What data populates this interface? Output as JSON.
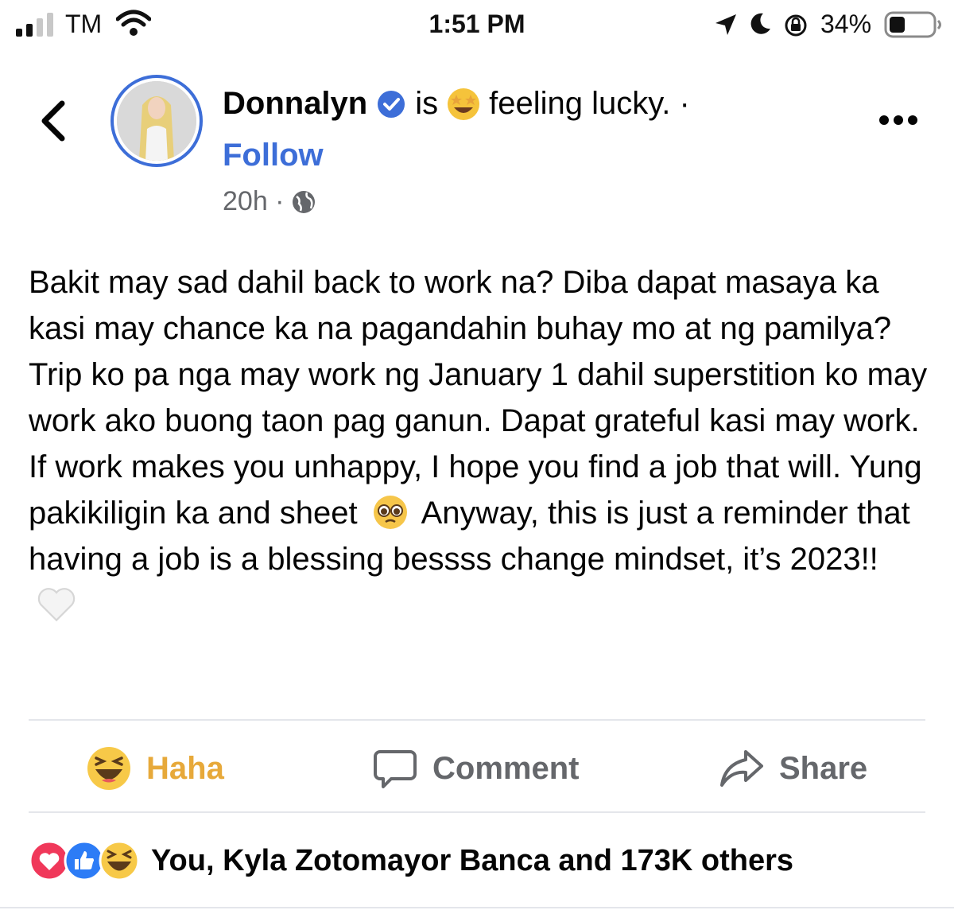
{
  "status_bar": {
    "carrier": "TM",
    "time": "1:51 PM",
    "battery": "34%"
  },
  "post": {
    "author": "Donnalyn",
    "activity_prefix": "is",
    "activity": "feeling lucky. ·",
    "follow_label": "Follow",
    "time_ago": "20h ·",
    "text_parts": [
      "Bakit may sad dahil back to work na? Diba dapat masaya ka kasi may chance ka na pagandahin buhay mo at ng pamilya? Trip ko pa nga may work ng January 1 dahil superstition ko may work ako buong taon pag ganun. Dapat grateful kasi may work. If work makes you unhappy, I hope you find a job that will. Yung pakikiligin ka and sheet",
      "Anyway, this is just a reminder that having a job is a blessing bessss change mindset, it’s 2023!!"
    ]
  },
  "actions": {
    "reaction_label": "Haha",
    "comment_label": "Comment",
    "share_label": "Share"
  },
  "reactions_summary": {
    "text": "You, Kyla Zotomayor Banca and 173K others"
  },
  "colors": {
    "link_blue": "#3d6ed8",
    "haha_yellow": "#e7a93a",
    "secondary_gray": "#65676b"
  }
}
